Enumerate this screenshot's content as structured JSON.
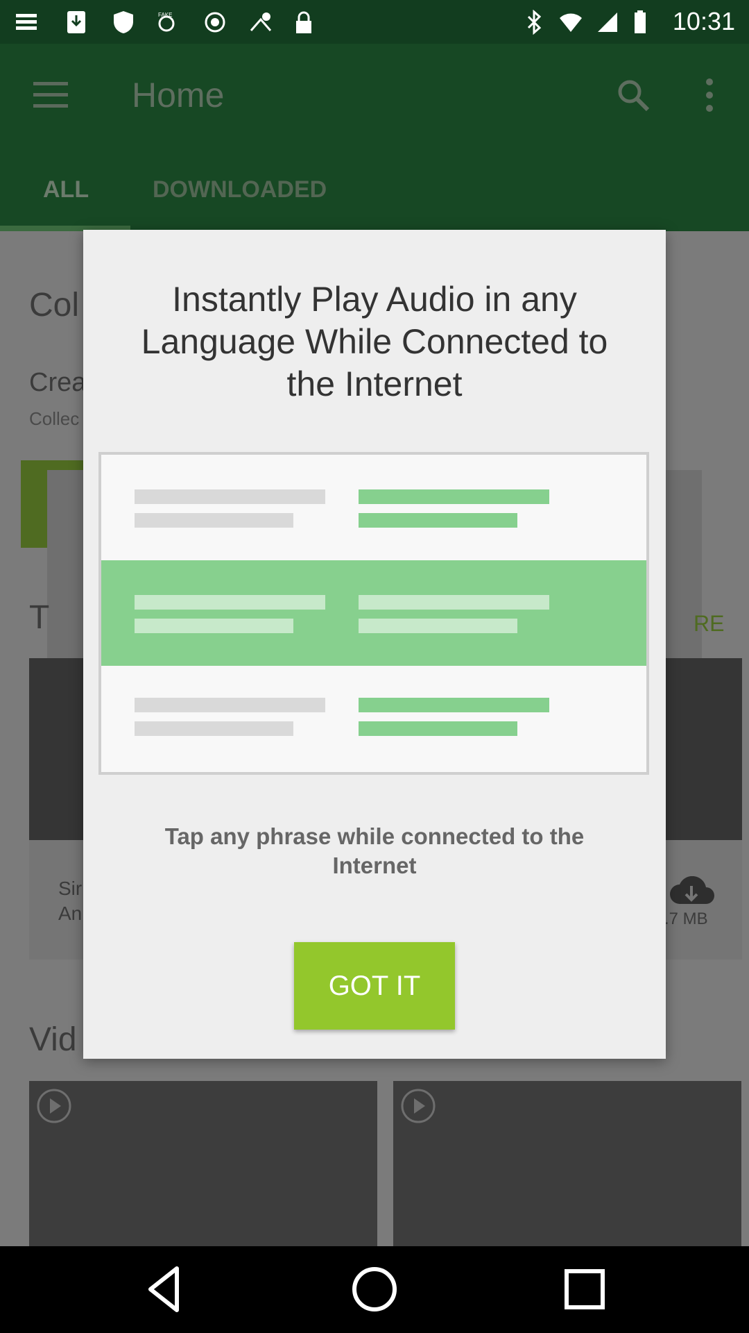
{
  "status_bar": {
    "time": "10:31",
    "icons": [
      "menu-lines-icon",
      "download-icon",
      "shield-icon",
      "fake-gps-icon",
      "satellite-icon",
      "lock-icon",
      "bluetooth-icon",
      "wifi-icon",
      "signal-icon",
      "battery-icon"
    ]
  },
  "app_bar": {
    "title": "Home",
    "tabs": [
      {
        "label": "ALL",
        "selected": true
      },
      {
        "label": "DOWNLOADED",
        "selected": false
      }
    ]
  },
  "background": {
    "section_title_fragment": "Col",
    "row_title_fragment": "Crea",
    "row_subtitle_fragment": "Collec",
    "section2_fragment": "T",
    "more_fragment": "RE",
    "card_text_fragment": "Sir\nAn",
    "card_size_fragment": ".7 MB",
    "videos_fragment": "Vid"
  },
  "dialog": {
    "title": "Instantly Play Audio in any Language While Connected to the Internet",
    "message": "Tap any phrase while connected to the Internet",
    "button_label": "GOT IT"
  },
  "colors": {
    "accent_green": "#93c72c",
    "illustration_green": "#86d08e",
    "app_bar_dimmed": "#174824"
  }
}
